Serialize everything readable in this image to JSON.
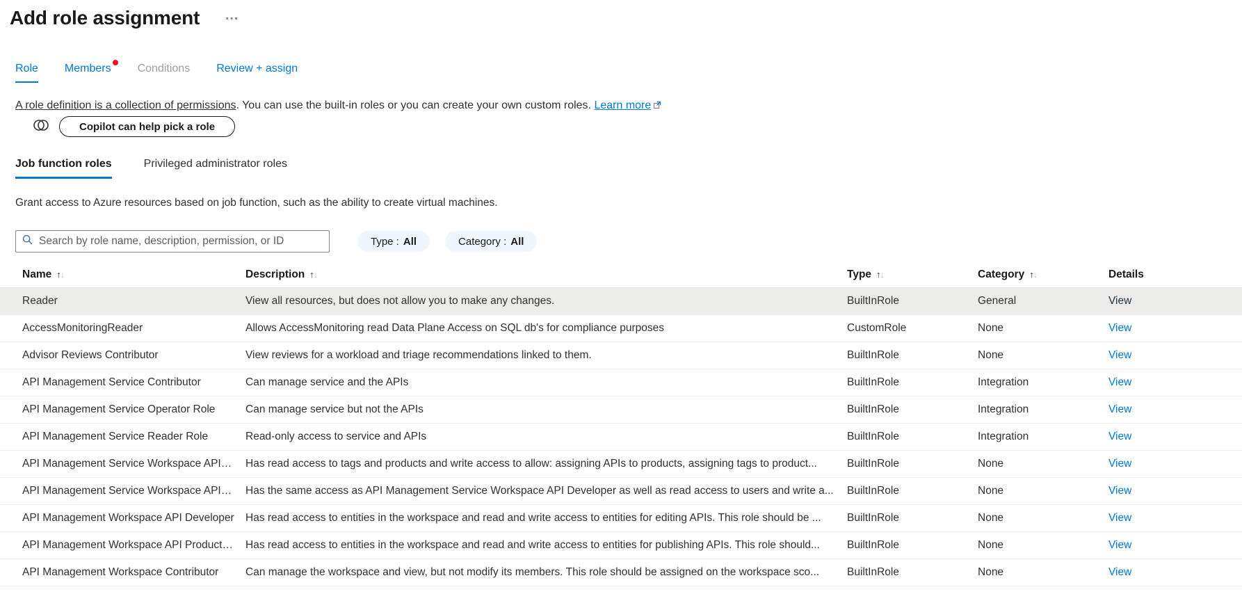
{
  "page": {
    "title": "Add role assignment",
    "more_label": "…"
  },
  "tabs": [
    {
      "label": "Role",
      "state": "active",
      "badge": false
    },
    {
      "label": "Members",
      "state": "normal",
      "badge": true
    },
    {
      "label": "Conditions",
      "state": "disabled",
      "badge": false
    },
    {
      "label": "Review + assign",
      "state": "normal",
      "badge": false
    }
  ],
  "intro": {
    "definition_text": "A role definition is a collection of permissions",
    "rest_text": ". You can use the built-in roles or you can create your own custom roles. ",
    "learn_more_label": "Learn more"
  },
  "copilot": {
    "button_label": "Copilot can help pick a role"
  },
  "subtabs": [
    {
      "label": "Job function roles",
      "active": true
    },
    {
      "label": "Privileged administrator roles",
      "active": false
    }
  ],
  "subtab_description": "Grant access to Azure resources based on job function, such as the ability to create virtual machines.",
  "filters": {
    "search_placeholder": "Search by role name, description, permission, or ID",
    "type_label": "Type :",
    "type_value": "All",
    "category_label": "Category :",
    "category_value": "All"
  },
  "icons": {
    "sort_up": "↑",
    "sort_down": "↓"
  },
  "table": {
    "columns": [
      {
        "label": "Name",
        "sortable": true
      },
      {
        "label": "Description",
        "sortable": true
      },
      {
        "label": "Type",
        "sortable": true
      },
      {
        "label": "Category",
        "sortable": true
      },
      {
        "label": "Details",
        "sortable": false
      }
    ],
    "rows": [
      {
        "name": "Reader",
        "description": "View all resources, but does not allow you to make any changes.",
        "type": "BuiltInRole",
        "category": "General",
        "details_label": "View",
        "selected": true
      },
      {
        "name": "AccessMonitoringReader",
        "description": "Allows AccessMonitoring read Data Plane Access on SQL db's for compliance purposes",
        "type": "CustomRole",
        "category": "None",
        "details_label": "View",
        "selected": false
      },
      {
        "name": "Advisor Reviews Contributor",
        "description": "View reviews for a workload and triage recommendations linked to them.",
        "type": "BuiltInRole",
        "category": "None",
        "details_label": "View",
        "selected": false
      },
      {
        "name": "API Management Service Contributor",
        "description": "Can manage service and the APIs",
        "type": "BuiltInRole",
        "category": "Integration",
        "details_label": "View",
        "selected": false
      },
      {
        "name": "API Management Service Operator Role",
        "description": "Can manage service but not the APIs",
        "type": "BuiltInRole",
        "category": "Integration",
        "details_label": "View",
        "selected": false
      },
      {
        "name": "API Management Service Reader Role",
        "description": "Read-only access to service and APIs",
        "type": "BuiltInRole",
        "category": "Integration",
        "details_label": "View",
        "selected": false
      },
      {
        "name": "API Management Service Workspace API Dev...",
        "description": "Has read access to tags and products and write access to allow: assigning APIs to products, assigning tags to product...",
        "type": "BuiltInRole",
        "category": "None",
        "details_label": "View",
        "selected": false
      },
      {
        "name": "API Management Service Workspace API Prod...",
        "description": "Has the same access as API Management Service Workspace API Developer as well as read access to users and write a...",
        "type": "BuiltInRole",
        "category": "None",
        "details_label": "View",
        "selected": false
      },
      {
        "name": "API Management Workspace API Developer",
        "description": "Has read access to entities in the workspace and read and write access to entities for editing APIs. This role should be ...",
        "type": "BuiltInRole",
        "category": "None",
        "details_label": "View",
        "selected": false
      },
      {
        "name": "API Management Workspace API Product Ma...",
        "description": "Has read access to entities in the workspace and read and write access to entities for publishing APIs. This role should...",
        "type": "BuiltInRole",
        "category": "None",
        "details_label": "View",
        "selected": false
      },
      {
        "name": "API Management Workspace Contributor",
        "description": "Can manage the workspace and view, but not modify its members. This role should be assigned on the workspace sco...",
        "type": "BuiltInRole",
        "category": "None",
        "details_label": "View",
        "selected": false
      }
    ]
  },
  "colors": {
    "accent": "#0078d4",
    "title_text": "#1b1a19",
    "body_text": "#323130",
    "disabled_text": "#a19f9d",
    "badge_red": "#e81123",
    "pill_background": "#eff6fc",
    "selected_row_background": "#ececeb",
    "row_border": "#f1efed",
    "view_link": "#0078d4",
    "view_link_selected": "#243240"
  }
}
